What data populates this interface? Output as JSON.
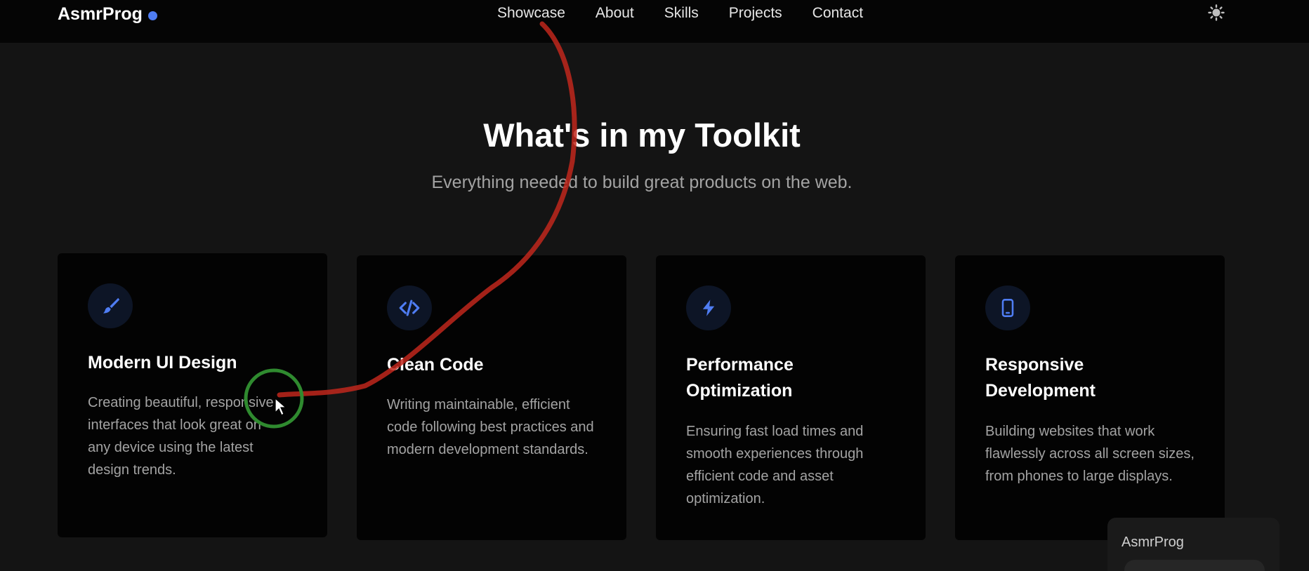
{
  "brand": {
    "name": "AsmrProg",
    "dot_color": "#4f7df3"
  },
  "nav": {
    "links": [
      {
        "label": "Showcase"
      },
      {
        "label": "About"
      },
      {
        "label": "Skills"
      },
      {
        "label": "Projects"
      },
      {
        "label": "Contact"
      }
    ],
    "theme_toggle_icon": "sun-icon"
  },
  "section": {
    "title": "What's in my Toolkit",
    "subtitle": "Everything needed to build great products on the web."
  },
  "cards": [
    {
      "icon": "paintbrush-icon",
      "title": "Modern UI Design",
      "description": "Creating beautiful, responsive interfaces that look great on any device using the latest design trends."
    },
    {
      "icon": "code-icon",
      "title": "Clean Code",
      "description": "Writing maintainable, efficient code following best practices and modern development standards."
    },
    {
      "icon": "lightning-bolt-icon",
      "title": "Performance Optimization",
      "description": "Ensuring fast load times and smooth experiences through efficient code and asset optimization."
    },
    {
      "icon": "mobile-phone-icon",
      "title": "Responsive Development",
      "description": "Building websites that work flawlessly across all screen sizes, from phones to large displays."
    }
  ],
  "chat_widget": {
    "label": "AsmrProg"
  },
  "colors": {
    "accent": "#4f7df3",
    "annotation_stroke": "#c0271c",
    "cursor_ring": "#2f8a2f"
  }
}
